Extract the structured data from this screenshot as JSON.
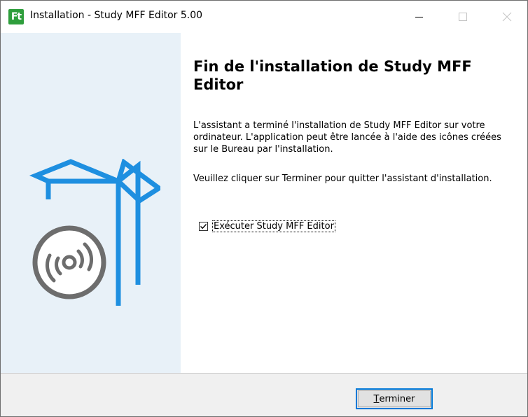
{
  "window": {
    "title": "Installation - Study MFF Editor 5.00",
    "app_icon_text": "Ft",
    "controls": [
      "minimize-icon",
      "maximize-icon",
      "close-icon"
    ]
  },
  "page": {
    "heading": "Fin de l'installation de Study MFF Editor",
    "paragraph1": "L'assistant a terminé l'installation de Study MFF Editor sur votre ordinateur. L'application peut être lancée à l'aide des icônes créées sur le Bureau par l'installation.",
    "paragraph2": "Veuillez cliquer sur Terminer pour quitter l'assistant d'installation.",
    "run_checkbox": {
      "label": "Exécuter Study MFF Editor",
      "checked": true
    }
  },
  "footer": {
    "finish_button_mnemonic": "T",
    "finish_button_rest": "erminer"
  },
  "colors": {
    "sidebar_bg": "#e8f1f8",
    "illustration_blue": "#1e8fe0",
    "disc_gray": "#6d6d6d",
    "app_icon_green": "#2e9e3c",
    "button_focus_border": "#0078d7"
  },
  "icons": [
    "box-disc-illustration",
    "checkmark-icon"
  ]
}
